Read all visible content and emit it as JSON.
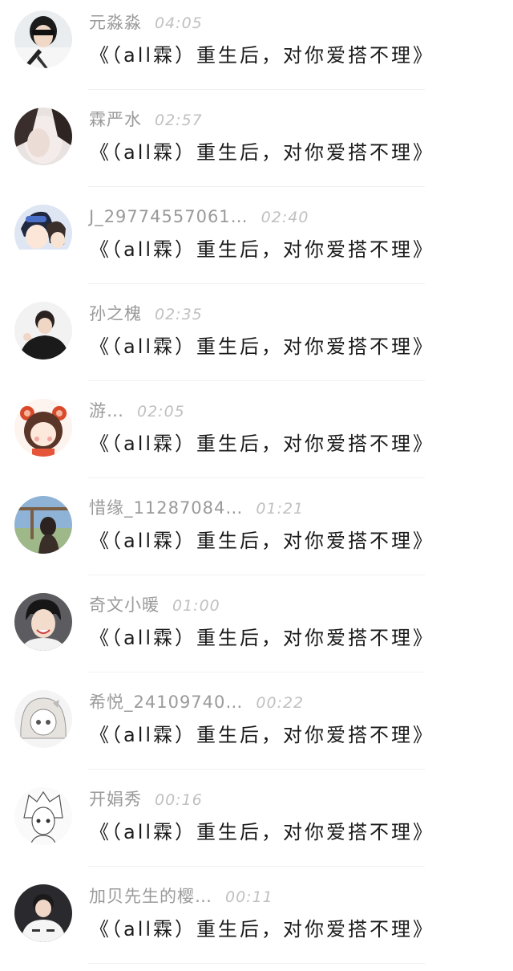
{
  "comments": [
    {
      "name": "元淼淼",
      "time": "04:05",
      "message": "《（all霖）重生后，对你爱搭不理》",
      "avatar": "photo-sunglasses-avatar"
    },
    {
      "name": "霖严水",
      "time": "02:57",
      "message": "《（all霖）重生后，对你爱搭不理》",
      "avatar": "photo-hand-face-avatar"
    },
    {
      "name": "J_29774557061…",
      "time": "02:40",
      "message": "《（all霖）重生后，对你爱搭不理》",
      "avatar": "anime-boys-avatar"
    },
    {
      "name": "孙之槐",
      "time": "02:35",
      "message": "《（all霖）重生后，对你爱搭不理》",
      "avatar": "photo-boy-peace-sign-avatar"
    },
    {
      "name": "游…",
      "time": "02:05",
      "message": "《（all霖）重生后，对你爱搭不理》",
      "avatar": "cartoon-bear-girl-avatar"
    },
    {
      "name": "惜缘_11287084…",
      "time": "01:21",
      "message": "《（all霖）重生后，对你爱搭不理》",
      "avatar": "photo-girl-sky-avatar"
    },
    {
      "name": "奇文小暖",
      "time": "01:00",
      "message": "《（all霖）重生后，对你爱搭不理》",
      "avatar": "photo-smiling-boy-avatar"
    },
    {
      "name": "希悦_24109740…",
      "time": "00:22",
      "message": "《（all霖）重生后，对你爱搭不理》",
      "avatar": "sketch-anime-girl-avatar"
    },
    {
      "name": "开娟秀",
      "time": "00:16",
      "message": "《（all霖）重生后，对你爱搭不理》",
      "avatar": "sketch-anime-boy-avatar"
    },
    {
      "name": "加贝先生的樱…",
      "time": "00:11",
      "message": "《（all霖）重生后，对你爱搭不理》",
      "avatar": "photo-boy-white-shirt-avatar"
    }
  ]
}
